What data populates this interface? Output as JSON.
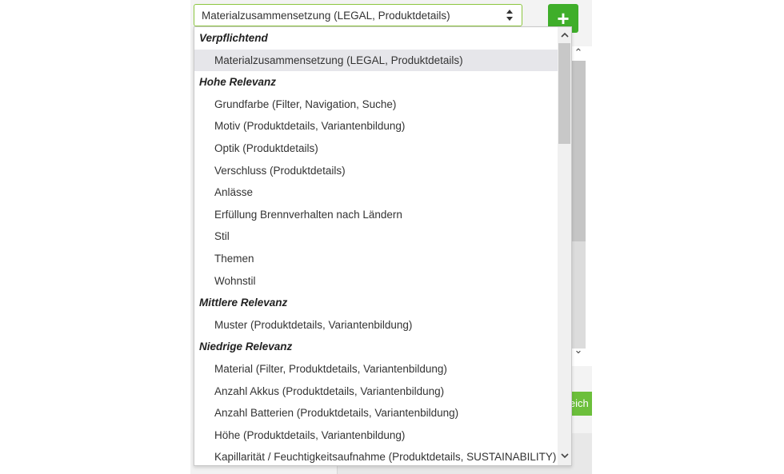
{
  "select": {
    "value": "Materialzusammensetzung (LEGAL, Produktdetails)"
  },
  "add_button": {
    "label": "+"
  },
  "background": {
    "save_button_fragment": "Speich"
  },
  "dropdown": {
    "groups": [
      {
        "label": "Verpflichtend",
        "options": [
          "Materialzusammensetzung (LEGAL, Produktdetails)"
        ]
      },
      {
        "label": "Hohe Relevanz",
        "options": [
          "Grundfarbe (Filter, Navigation, Suche)",
          "Motiv (Produktdetails, Variantenbildung)",
          "Optik (Produktdetails)",
          "Verschluss (Produktdetails)",
          "Anlässe",
          "Erfüllung Brennverhalten nach Ländern",
          "Stil",
          "Themen",
          "Wohnstil"
        ]
      },
      {
        "label": "Mittlere Relevanz",
        "options": [
          "Muster (Produktdetails, Variantenbildung)"
        ]
      },
      {
        "label": "Niedrige Relevanz",
        "options": [
          "Material (Filter, Produktdetails, Variantenbildung)",
          "Anzahl Akkus (Produktdetails, Variantenbildung)",
          "Anzahl Batterien (Produktdetails, Variantenbildung)",
          "Höhe (Produktdetails, Variantenbildung)",
          "Kapillarität / Feuchtigkeitsaufnahme (Produktdetails, SUSTAINABILITY)"
        ]
      }
    ],
    "selected_option": "Materialzusammensetzung (LEGAL, Produktdetails)"
  },
  "icons": {
    "select_caret": "sort-caret-icon",
    "add": "plus-icon",
    "scroll_up": "chevron-up-icon",
    "scroll_down": "chevron-down-icon"
  },
  "colors": {
    "accent_green": "#3fae2a",
    "focus_border": "#8cc63f",
    "selected_bg": "#e6e6ea"
  }
}
